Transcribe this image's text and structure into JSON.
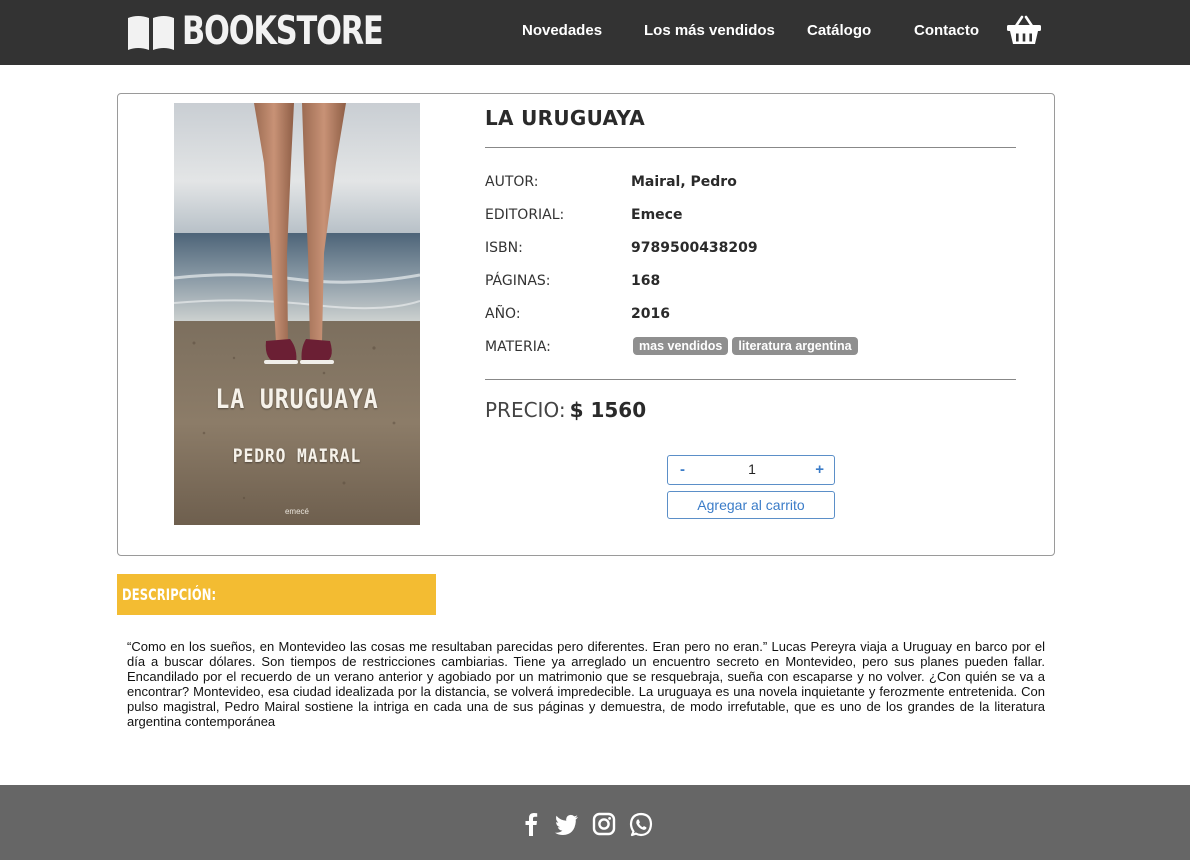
{
  "header": {
    "brand": "BOOKSTORE",
    "nav": [
      {
        "label": "Novedades"
      },
      {
        "label": "Los más vendidos"
      },
      {
        "label": "Catálogo"
      },
      {
        "label": "Contacto"
      }
    ],
    "cart_icon": "basket-icon"
  },
  "product": {
    "cover": {
      "title": "LA URUGUAYA",
      "author": "PEDRO MAIRAL",
      "publisher": "emecé"
    },
    "title": "LA URUGUAYA",
    "fields": {
      "author": {
        "label": "AUTOR:",
        "value": "Mairal, Pedro"
      },
      "publisher": {
        "label": "EDITORIAL:",
        "value": "Emece"
      },
      "isbn": {
        "label": "ISBN:",
        "value": "9789500438209"
      },
      "pages": {
        "label": "PÁGINAS:",
        "value": "168"
      },
      "year": {
        "label": "AÑO:",
        "value": "2016"
      },
      "subject": {
        "label": "MATERIA:",
        "tags": [
          "mas vendidos",
          "literatura argentina"
        ]
      }
    },
    "price": {
      "label": "PRECIO:",
      "value": "$ 1560"
    },
    "quantity": {
      "minus": "-",
      "value": "1",
      "plus": "+"
    },
    "add_to_cart": "Agregar al carrito"
  },
  "description": {
    "heading": "DESCRIPCIÓN:",
    "text": "“Como en los sueños, en Montevideo las cosas me resultaban parecidas pero diferentes. Eran pero no eran.” Lucas Pereyra viaja a Uruguay en barco por el día a buscar dólares. Son tiempos de restricciones cambiarias. Tiene ya arreglado un encuentro secreto en Montevideo, pero sus planes pueden fallar. Encandilado por el recuerdo de un verano anterior y agobiado por un matrimonio que se resquebraja, sueña con escaparse y no volver. ¿Con quién se va a encontrar? Montevideo, esa ciudad idealizada por la distancia, se volverá impredecible. La uruguaya es una novela inquietante y ferozmente entretenida. Con pulso magistral, Pedro Mairal sostiene la intriga en cada una de sus páginas y demuestra, de modo irrefutable, que es uno de los grandes de la literatura argentina contemporánea"
  },
  "footer": {
    "social": [
      "facebook-icon",
      "twitter-icon",
      "instagram-icon",
      "whatsapp-icon"
    ]
  },
  "colors": {
    "header_bg": "#333333",
    "footer_bg": "#666666",
    "accent": "#f3bc32",
    "button_blue": "#3b7cc8"
  }
}
